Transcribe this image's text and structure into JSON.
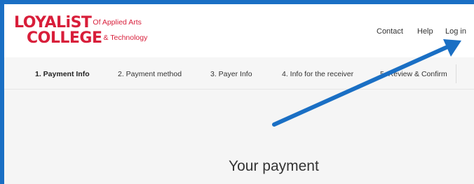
{
  "header": {
    "logo": {
      "word1": "LOYALiST",
      "word1_suffix": "Of Applied Arts",
      "word2": "COLLEGE",
      "word2_suffix": "& Technology"
    },
    "nav": {
      "contact": "Contact",
      "help": "Help",
      "login": "Log in"
    }
  },
  "steps": [
    {
      "label": "1. Payment Info",
      "active": true
    },
    {
      "label": "2. Payment method",
      "active": false
    },
    {
      "label": "3. Payer Info",
      "active": false
    },
    {
      "label": "4. Info for the receiver",
      "active": false
    },
    {
      "label": "5. Review & Confirm",
      "active": false
    }
  ],
  "main": {
    "title": "Your payment"
  },
  "colors": {
    "brand_red": "#d81e3a",
    "annotation_blue": "#1a6fc4",
    "page_bg": "#f5f5f5"
  },
  "annotation": {
    "icon": "arrow-pointer-icon",
    "points_to": "login-link"
  }
}
